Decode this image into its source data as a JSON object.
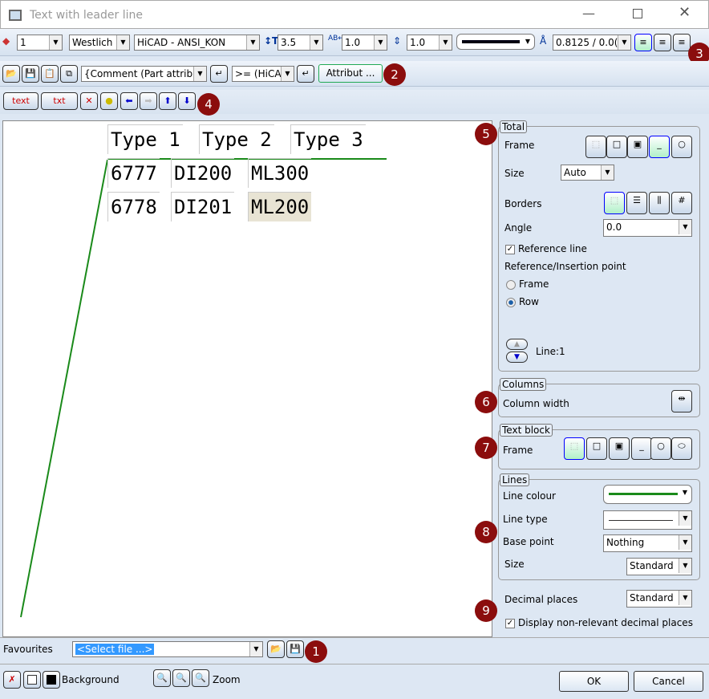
{
  "window": {
    "title": "Text with leader line"
  },
  "toolbar1": {
    "layer": "1",
    "font_style": "Westlich",
    "font": "HiCAD - ANSI_KON",
    "height": "3.5",
    "width_ratio": "1.0",
    "line_spacing": "1.0",
    "ratio": "0.8125 / 0.0("
  },
  "toolbar2": {
    "attribute_combo": "{Comment (Part attribu",
    "operator_combo": ">= (HiCA",
    "attribut_button": "Attribut ..."
  },
  "toolbar3": {
    "text_button": "text",
    "txt_button": "txt"
  },
  "badges": [
    "1",
    "2",
    "3",
    "4",
    "5",
    "6",
    "7",
    "8",
    "9"
  ],
  "table": {
    "headers": [
      "Type 1",
      "Type 2",
      "Type 3"
    ],
    "rows": [
      [
        "6777",
        "DI200",
        "ML300"
      ],
      [
        "6778",
        "DI201",
        "ML200"
      ]
    ]
  },
  "total": {
    "legend": "Total",
    "frame_label": "Frame",
    "size_label": "Size",
    "size_value": "Auto",
    "borders_label": "Borders",
    "angle_label": "Angle",
    "angle_value": "0.0",
    "reference_line": "Reference line",
    "reference_line_checked": true,
    "ref_point_label": "Reference/Insertion point",
    "option_frame": "Frame",
    "option_row": "Row",
    "selected": "Row",
    "line_label": "Line:1"
  },
  "columns": {
    "legend": "Columns",
    "column_width": "Column width"
  },
  "textblock": {
    "legend": "Text block",
    "frame_label": "Frame"
  },
  "lines": {
    "legend": "Lines",
    "line_colour": "Line colour",
    "line_colour_value": "#1a8a1a",
    "line_type": "Line type",
    "base_point": "Base point",
    "base_point_value": "Nothing",
    "size": "Size",
    "size_value": "Standard"
  },
  "decimal": {
    "label": "Decimal places",
    "value": "Standard",
    "display_nonrelevant": "Display non-relevant decimal places",
    "checked": true
  },
  "favourites": {
    "label": "Favourites",
    "value": "<Select file ...>"
  },
  "bottom": {
    "background": "Background",
    "zoom": "Zoom",
    "ok": "OK",
    "cancel": "Cancel"
  }
}
